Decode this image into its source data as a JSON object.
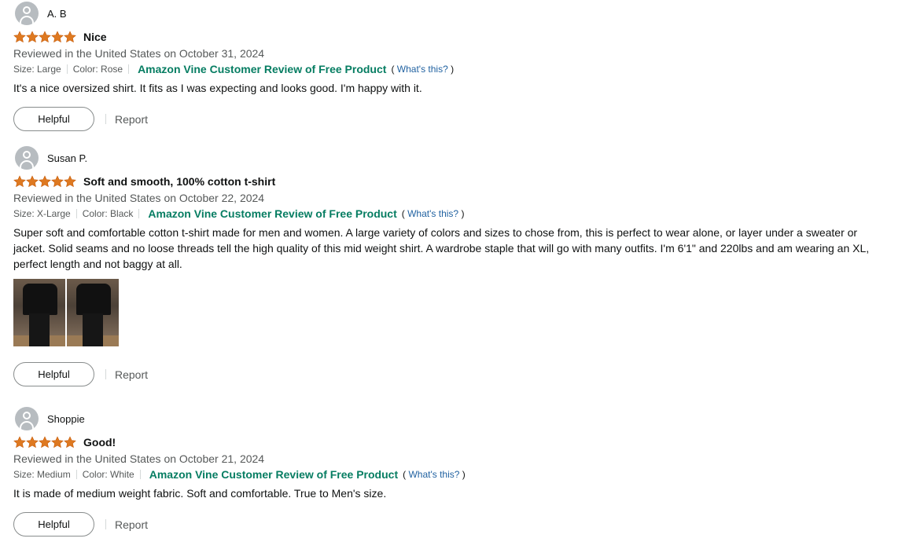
{
  "colors": {
    "star": "#de7921",
    "vine": "#067d62",
    "link": "#2162a1",
    "muted": "#565959"
  },
  "reviews": [
    {
      "author": "A. B",
      "rating": 5,
      "title": "Nice",
      "reviewed": "Reviewed in the United States on October 31, 2024",
      "size": "Size: Large",
      "color": "Color: Rose",
      "vine": "Amazon Vine Customer Review of Free Product",
      "whats_open": "(",
      "whats": "What's this?",
      "whats_close": ")",
      "body": "It's a nice oversized shirt. It fits as I was expecting and looks good. I'm happy with it.",
      "helpful": "Helpful",
      "report": "Report"
    },
    {
      "author": "Susan P.",
      "rating": 5,
      "title": "Soft and smooth, 100% cotton t-shirt",
      "reviewed": "Reviewed in the United States on October 22, 2024",
      "size": "Size: X-Large",
      "color": "Color: Black",
      "vine": "Amazon Vine Customer Review of Free Product",
      "whats_open": "(",
      "whats": "What's this?",
      "whats_close": ")",
      "body": "Super soft and comfortable cotton t-shirt made for men and women. A large variety of colors and sizes to chose from, this is perfect to wear alone, or layer under a sweater or jacket. Solid seams and no loose threads tell the high quality of this mid weight shirt. A wardrobe staple that will go with many outfits. I'm 6'1\" and 220lbs and am wearing an XL, perfect length and not baggy at all.",
      "helpful": "Helpful",
      "report": "Report"
    },
    {
      "author": "Shoppie",
      "rating": 5,
      "title": "Good!",
      "reviewed": "Reviewed in the United States on October 21, 2024",
      "size": "Size: Medium",
      "color": "Color: White",
      "vine": "Amazon Vine Customer Review of Free Product",
      "whats_open": "(",
      "whats": "What's this?",
      "whats_close": ")",
      "body": "It is made of medium weight fabric. Soft and comfortable. True to Men's size.",
      "helpful": "Helpful",
      "report": "Report"
    }
  ]
}
